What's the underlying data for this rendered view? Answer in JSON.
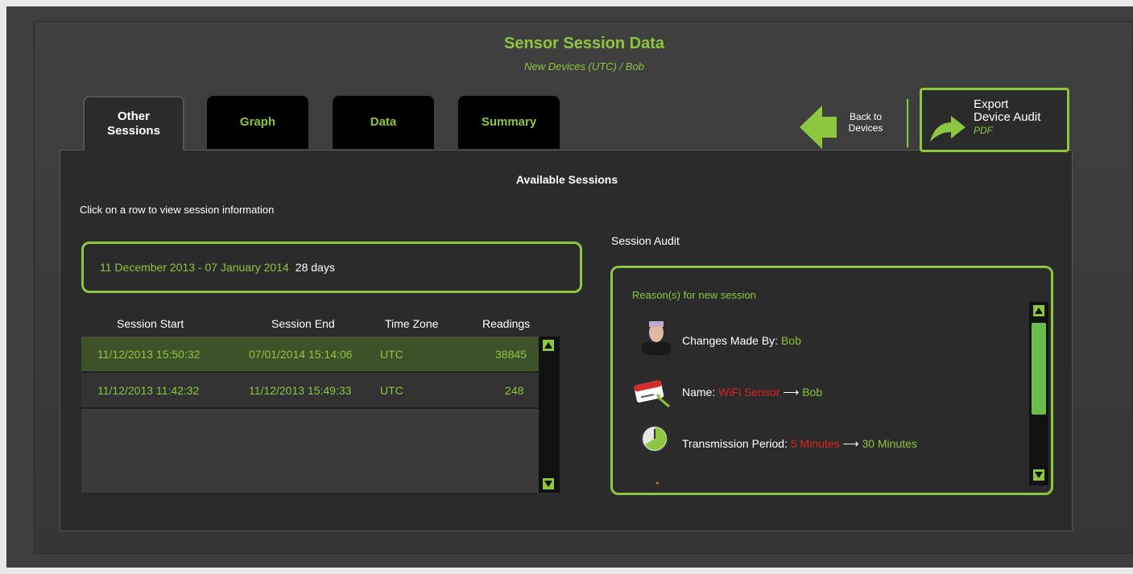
{
  "header": {
    "title": "Sensor Session Data",
    "subtitle": "New Devices  (UTC) / Bob"
  },
  "tabs": [
    {
      "label_line1": "Other",
      "label_line2": "Sessions",
      "active": true
    },
    {
      "label": "Graph"
    },
    {
      "label": "Data"
    },
    {
      "label": "Summary"
    }
  ],
  "back_button": {
    "line1": "Back to",
    "line2": "Devices"
  },
  "export_button": {
    "line1": "Export",
    "line2": "Device Audit",
    "line3": "PDF"
  },
  "sessions": {
    "title": "Available Sessions",
    "hint": "Click on a row to view session information",
    "selected_range": "11 December 2013 - 07 January 2014",
    "selected_days": "28 days",
    "columns": [
      "Session Start",
      "Session End",
      "Time Zone",
      "Readings"
    ],
    "rows": [
      {
        "start": "11/12/2013 15:50:32",
        "end": "07/01/2014 15:14:06",
        "tz": "UTC",
        "readings": "38845"
      },
      {
        "start": "11/12/2013 11:42:32",
        "end": "11/12/2013 15:49:33",
        "tz": "UTC",
        "readings": "248"
      }
    ]
  },
  "audit": {
    "label": "Session Audit",
    "reason_title": "Reason(s) for new session",
    "changes_label": "Changes Made By:",
    "changes_user": "Bob",
    "name_label": "Name:",
    "name_old": "WiFi Sensor",
    "name_arrow": "⟶",
    "name_new": "Bob",
    "period_label": "Transmission Period:",
    "period_old": "5 Minutes",
    "period_arrow": "⟶",
    "period_new": "30 Minutes"
  },
  "colors": {
    "accent": "#8dc63f",
    "panel": "#2b2b2b",
    "changed_old": "#e02020"
  }
}
